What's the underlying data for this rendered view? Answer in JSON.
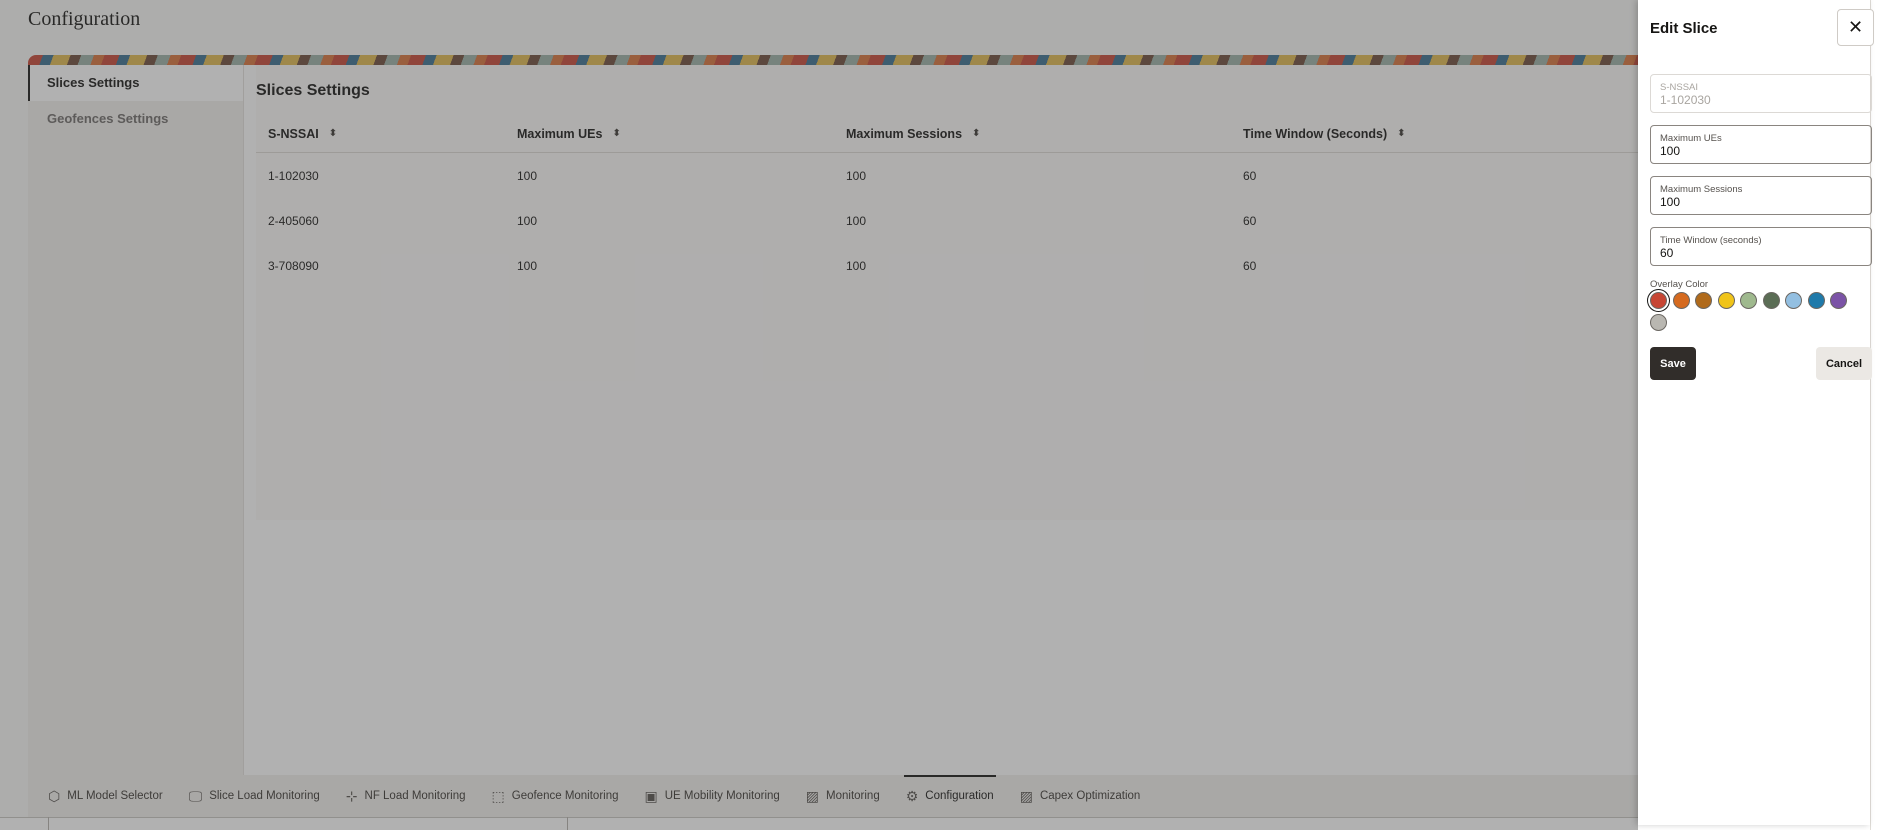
{
  "page": {
    "title": "Configuration"
  },
  "sidebar": {
    "items": [
      {
        "label": "Slices Settings"
      },
      {
        "label": "Geofences Settings"
      }
    ]
  },
  "main": {
    "title": "Slices Settings",
    "columns": [
      "S-NSSAI",
      "Maximum UEs",
      "Maximum Sessions",
      "Time Window (Seconds)"
    ],
    "rows": [
      [
        "1-102030",
        "100",
        "100",
        "60"
      ],
      [
        "2-405060",
        "100",
        "100",
        "60"
      ],
      [
        "3-708090",
        "100",
        "100",
        "60"
      ]
    ]
  },
  "bottom_nav": {
    "items": [
      {
        "label": "ML Model Selector",
        "icon": "cube-icon"
      },
      {
        "label": "Slice Load Monitoring",
        "icon": "monitor-icon"
      },
      {
        "label": "NF Load Monitoring",
        "icon": "network-icon"
      },
      {
        "label": "Geofence Monitoring",
        "icon": "geofence-icon"
      },
      {
        "label": "UE Mobility Monitoring",
        "icon": "mobility-icon"
      },
      {
        "label": "Monitoring",
        "icon": "chart-icon"
      },
      {
        "label": "Configuration",
        "icon": "gear-icon",
        "active": true
      },
      {
        "label": "Capex Optimization",
        "icon": "chart-icon"
      }
    ]
  },
  "drawer": {
    "title": "Edit Slice",
    "fields": {
      "snssai": {
        "label": "S-NSSAI",
        "value": "1-102030"
      },
      "max_ues": {
        "label": "Maximum UEs",
        "value": "100"
      },
      "max_sessions": {
        "label": "Maximum Sessions",
        "value": "100"
      },
      "time_window": {
        "label": "Time Window (seconds)",
        "value": "60"
      }
    },
    "overlay_color": {
      "label": "Overlay Color",
      "colors": [
        "#c74634",
        "#d56a1f",
        "#b06a1b",
        "#f0c419",
        "#9fb98e",
        "#5b6d55",
        "#93bfe1",
        "#1f7aaa",
        "#7b53a6",
        "#b9b7b1"
      ],
      "selected": "#c74634"
    },
    "save_label": "Save",
    "cancel_label": "Cancel"
  }
}
